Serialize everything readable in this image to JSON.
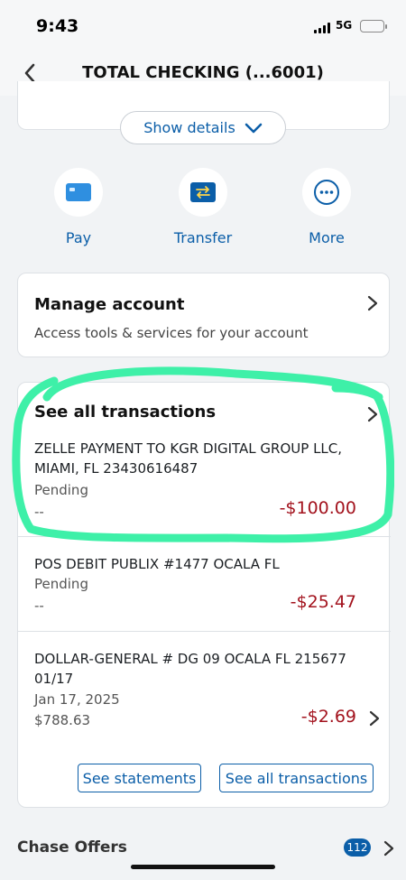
{
  "status_bar": {
    "time": "9:43",
    "network": "5G"
  },
  "nav": {
    "title": "TOTAL CHECKING (...6001)",
    "back_icon": "chevron-left-icon"
  },
  "show_details": {
    "label": "Show details",
    "icon": "chevron-down-icon"
  },
  "actions": [
    {
      "label": "Pay",
      "icon": "card-icon"
    },
    {
      "label": "Transfer",
      "icon": "transfer-icon"
    },
    {
      "label": "More",
      "icon": "more-icon"
    }
  ],
  "manage_account": {
    "title": "Manage account",
    "subtitle": "Access tools & services for your account"
  },
  "transactions": {
    "header": "See all transactions",
    "items": [
      {
        "line1": "ZELLE PAYMENT TO KGR DIGITAL GROUP LLC,",
        "line2": "MIAMI, FL 23430616487",
        "status": "Pending",
        "sub": "--",
        "amount": "-$100.00"
      },
      {
        "line1": "POS DEBIT PUBLIX #1477 OCALA FL",
        "line2": "",
        "status": "Pending",
        "sub": "--",
        "amount": "-$25.47"
      },
      {
        "line1": "DOLLAR-GENERAL # DG 09 OCALA FL 215677",
        "line2": "01/17",
        "status": "Jan 17, 2025",
        "sub": "$788.63",
        "amount": "-$2.69"
      }
    ],
    "see_statements": "See statements",
    "see_all": "See all transactions"
  },
  "offers": {
    "label": "Chase Offers",
    "badge": "112"
  },
  "colors": {
    "accent": "#0b5ea8",
    "debit": "#a3131e",
    "highlight": "#3ef0a8"
  }
}
